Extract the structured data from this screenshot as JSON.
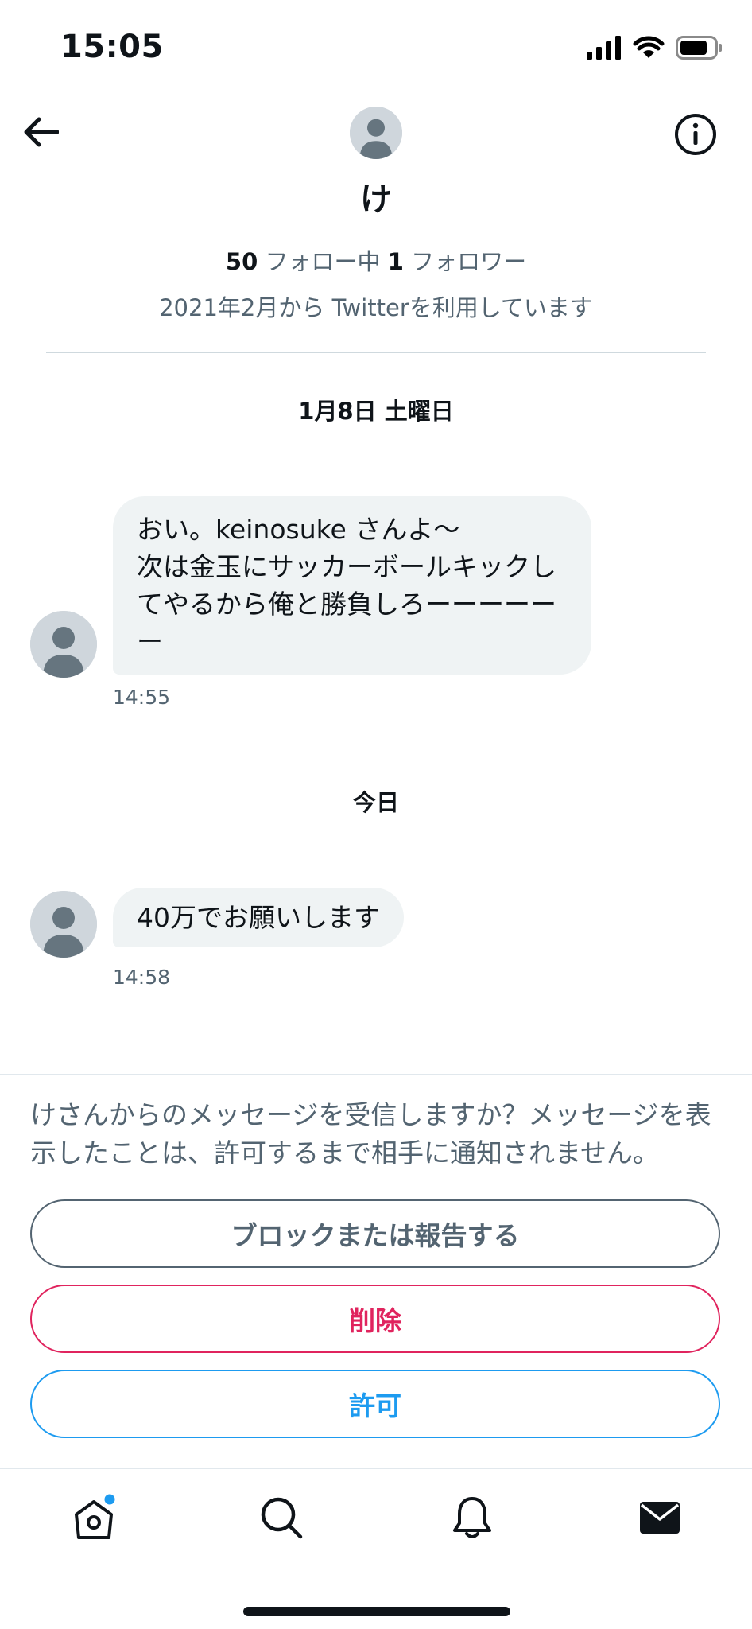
{
  "status_bar": {
    "time": "15:05"
  },
  "profile": {
    "name": "け",
    "following_count": "50",
    "following_label": " フォロー中 ",
    "followers_count": "1",
    "followers_label": " フォロワー",
    "joined": "2021年2月から Twitterを利用しています"
  },
  "conversation": [
    {
      "date_label": "1月8日 土曜日",
      "message": "おい。keinosuke さんよ〜\n次は金玉にサッカーボールキックしてやるから俺と勝負しろーーーーーー",
      "time": "14:55"
    },
    {
      "date_label": "今日",
      "message": "40万でお願いします",
      "time": "14:58"
    }
  ],
  "request": {
    "prompt": "けさんからのメッセージを受信しますか？メッセージを表示したことは、許可するまで相手に通知されません。",
    "block_label": "ブロックまたは報告する",
    "delete_label": "削除",
    "allow_label": "許可"
  },
  "icons": {
    "back": "back-arrow-icon",
    "info": "info-icon",
    "tabs": [
      "home-icon",
      "search-icon",
      "notifications-icon",
      "messages-icon"
    ]
  },
  "colors": {
    "delete": "#e0245e",
    "allow": "#1d9bf0",
    "badge": "#1d9bf0",
    "bubble": "#eff3f4"
  }
}
